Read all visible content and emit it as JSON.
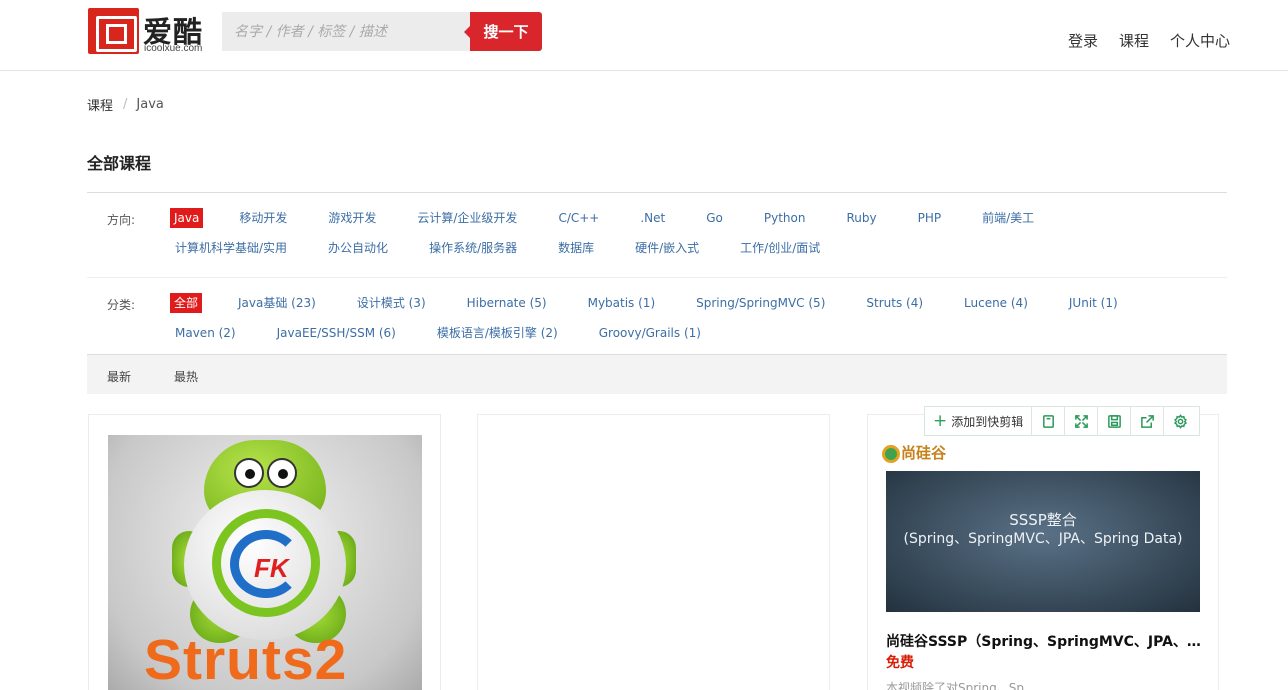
{
  "header": {
    "logo_text": "爱酷",
    "logo_domain": "icoolxue.com",
    "search_placeholder": "名字 / 作者 / 标签 / 描述",
    "search_button": "搜一下",
    "nav": [
      "登录",
      "课程",
      "个人中心"
    ]
  },
  "breadcrumb": {
    "home": "课程",
    "separator": "/",
    "current": "Java"
  },
  "section_title": "全部课程",
  "filters": {
    "direction_label": "方向:",
    "directions": [
      "Java",
      "移动开发",
      "游戏开发",
      "云计算/企业级开发",
      "C/C++",
      ".Net",
      "Go",
      "Python",
      "Ruby",
      "PHP",
      "前端/美工",
      "计算机科学基础/实用",
      "办公自动化",
      "操作系统/服务器",
      "数据库",
      "硬件/嵌入式",
      "工作/创业/面试"
    ],
    "category_label": "分类:",
    "categories": [
      "全部",
      "Java基础 (23)",
      "设计模式 (3)",
      "Hibernate (5)",
      "Mybatis (1)",
      "Spring/SpringMVC (5)",
      "Struts (4)",
      "Lucene (4)",
      "JUnit (1)",
      "Maven (2)",
      "JavaEE/SSH/SSM (6)",
      "模板语言/模板引擎 (2)",
      "Groovy/Grails (1)"
    ]
  },
  "sort": {
    "newest": "最新",
    "hottest": "最热"
  },
  "cards": {
    "card1": {
      "thumb_logo": "FK",
      "thumb_text": "Struts2"
    },
    "card3": {
      "brand": "尚硅谷",
      "banner_line1": "SSSP整合",
      "banner_line2": "(Spring、SpringMVC、JPA、Spring Data)",
      "title": "尚硅谷SSSP（Spring、SpringMVC、JPA、Spring Data）",
      "price": "免费",
      "desc": "本视频除了对Spring、Sp"
    }
  },
  "toolbar": {
    "add_label": "添加到快剪辑",
    "icons": [
      "copy-icon",
      "fullscreen-icon",
      "save-icon",
      "share-icon",
      "settings-icon"
    ]
  },
  "colors": {
    "accent_red": "#d9262c",
    "link_blue": "#3c6ea5",
    "active_bg": "#e01b1b",
    "toolbar_green": "#2b9a5c"
  }
}
